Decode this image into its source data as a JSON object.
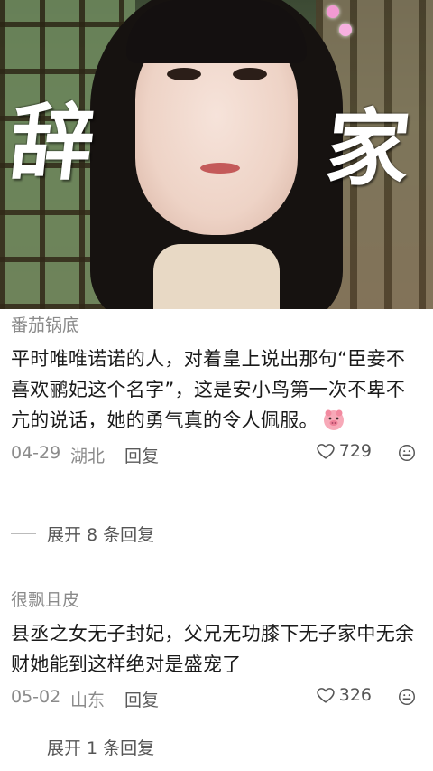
{
  "hero": {
    "title_left": "辞",
    "title_right": "家"
  },
  "comments": [
    {
      "username": "番茄锅底",
      "text": "平时唯唯诺诺的人，对着皇上说出那句“臣妾不喜欢鹂妃这个名字”，这是安小鸟第一次不卑不亢的说话，她的勇气真的令人佩服。",
      "date": "04-29",
      "region": "湖北",
      "reply_label": "回复",
      "likes": "729",
      "expand_label": "展开 8 条回复",
      "has_emoji": true
    },
    {
      "username": "很飘且皮",
      "text": "县丞之女无子封妃，父兄无功膝下无子家中无余财她能到这样绝对是盛宠了",
      "date": "05-02",
      "region": "山东",
      "reply_label": "回复",
      "likes": "326",
      "expand_label": "展开 1 条回复",
      "has_emoji": false
    }
  ],
  "colors": {
    "meta_gray": "#8a8a8a",
    "text": "#1a1a1a",
    "emoji_pink": "#f29ab0"
  },
  "icons": [
    "heart-icon",
    "smiley-icon",
    "pig-emoji-icon"
  ]
}
